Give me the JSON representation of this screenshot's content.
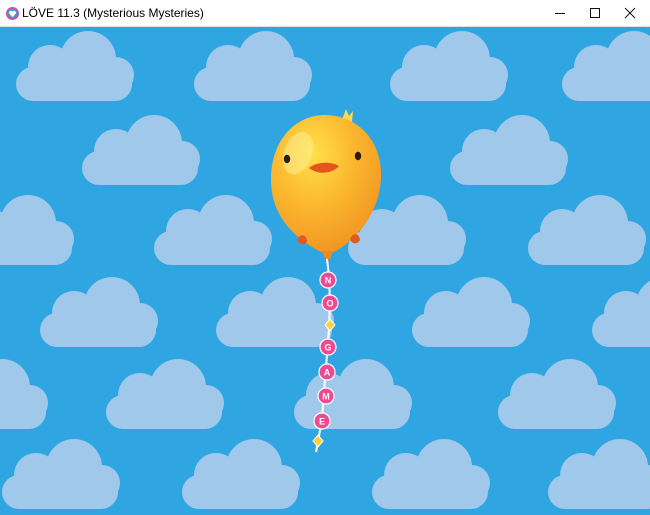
{
  "window": {
    "title": "LÖVE 11.3 (Mysterious Mysteries)",
    "icon": "love-heart-icon",
    "controls": [
      "minimize-icon",
      "maximize-icon",
      "close-icon"
    ]
  },
  "scene": {
    "sky_color": "#2fa6e2",
    "cloud_color": "#9fc8ea",
    "balloon_color": "#f7a72a",
    "balloon_highlight": "#ffd33f",
    "bead_color": "#ec4a93",
    "diamond_color": "#ffd23a",
    "string_letters": [
      "N",
      "O",
      "G",
      "A",
      "M",
      "E"
    ]
  }
}
